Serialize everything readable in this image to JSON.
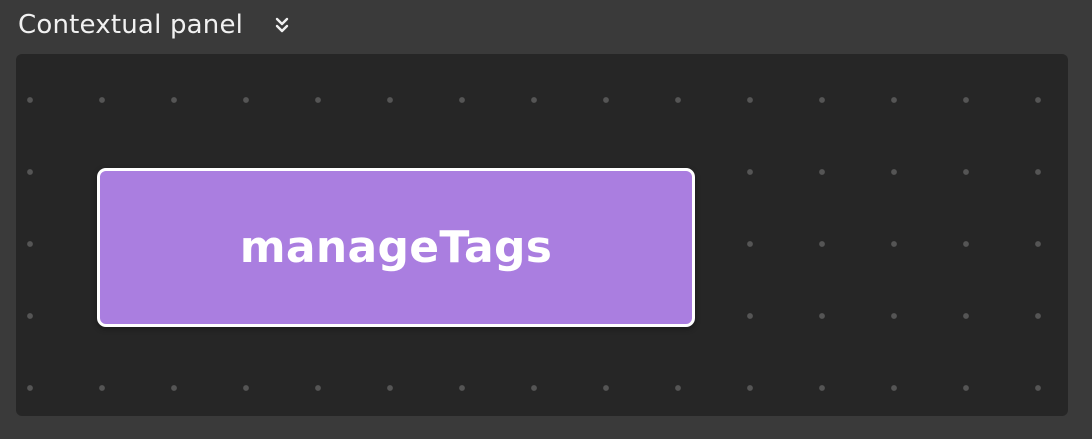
{
  "panel": {
    "title": "Contextual panel",
    "toggle_icon": "double-chevron-down-icon"
  },
  "canvas": {
    "background_color": "#262626",
    "dot_color": "#555555",
    "nodes": [
      {
        "label": "manageTags",
        "fill_color": "#aa7ee0",
        "border_color": "#ffffff"
      }
    ]
  }
}
